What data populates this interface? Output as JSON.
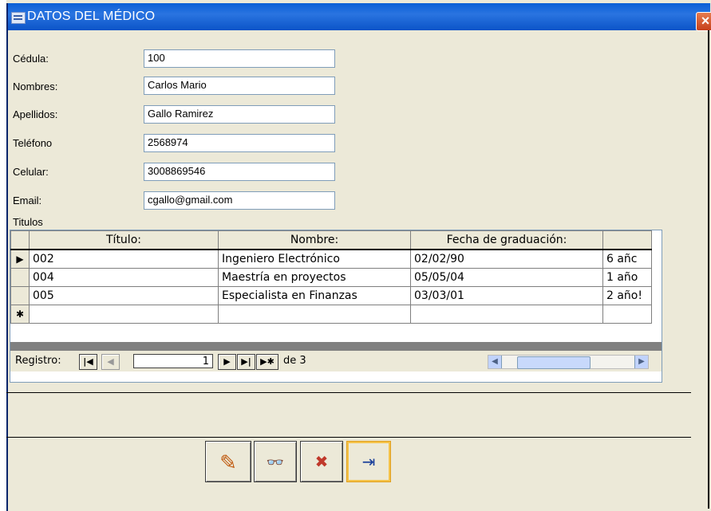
{
  "window": {
    "title": "DATOS DEL MÉDICO",
    "close_glyph": "×"
  },
  "form": {
    "fields": [
      {
        "label": "Cédula:",
        "value": "100"
      },
      {
        "label": "Nombres:",
        "value": "Carlos Mario"
      },
      {
        "label": "Apellidos:",
        "value": "Gallo Ramirez"
      },
      {
        "label": "Teléfono",
        "value": "2568974"
      },
      {
        "label": "Celular:",
        "value": "3008869546"
      },
      {
        "label": "Email:",
        "value": "cgallo@gmail.com"
      }
    ],
    "subform_label": "Titulos"
  },
  "grid": {
    "columns": [
      "Título:",
      "Nombre:",
      "Fecha de graduación:",
      ""
    ],
    "rows": [
      {
        "selector": "▶",
        "titulo": "002",
        "nombre": "Ingeniero Electrónico",
        "fecha": "02/02/90",
        "extra": " 6 añc"
      },
      {
        "selector": "",
        "titulo": "004",
        "nombre": "Maestría en proyectos",
        "fecha": "05/05/04",
        "extra": "1 año"
      },
      {
        "selector": "",
        "titulo": "005",
        "nombre": "Especialista en Finanzas",
        "fecha": "03/03/01",
        "extra": "2 año!"
      },
      {
        "selector": "✱",
        "titulo": "",
        "nombre": "",
        "fecha": "",
        "extra": ""
      }
    ]
  },
  "navigation": {
    "label": "Registro:",
    "current": "1",
    "of_text": "de 3",
    "first": "|◀",
    "prev": "◀",
    "next": "▶",
    "last": "▶|",
    "new": "▶✱"
  },
  "toolbar": {
    "buttons": [
      {
        "icon": "pencil-icon",
        "glyph": "✎"
      },
      {
        "icon": "binoculars-icon",
        "glyph": "👓"
      },
      {
        "icon": "delete-icon",
        "glyph": "✖"
      },
      {
        "icon": "exit-door-icon",
        "glyph": "⇥"
      }
    ]
  },
  "colors": {
    "titlebar": "#0a5fd6",
    "window_bg": "#ece9d8",
    "close": "#c6401c"
  }
}
